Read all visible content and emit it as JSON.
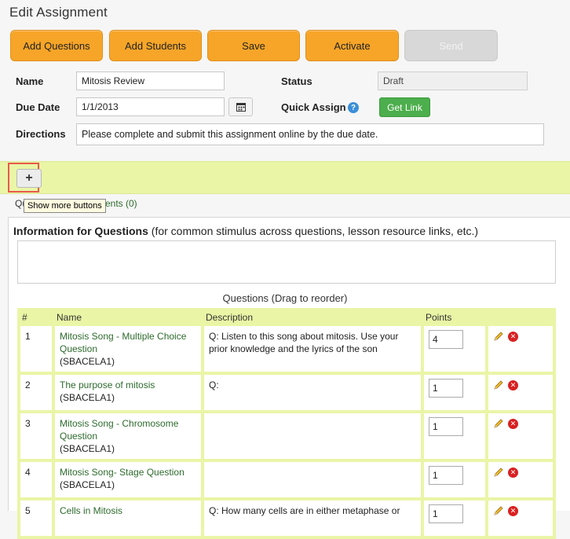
{
  "page": {
    "title": "Edit Assignment"
  },
  "toolbar": {
    "add_questions": "Add Questions",
    "add_students": "Add Students",
    "save": "Save",
    "activate": "Activate",
    "send": "Send"
  },
  "form": {
    "name_label": "Name",
    "name_value": "Mitosis Review",
    "status_label": "Status",
    "status_value": "Draft",
    "due_date_label": "Due Date",
    "due_date_value": "1/1/2013",
    "quick_assign_label": "Quick Assign",
    "get_link": "Get Link",
    "directions_label": "Directions",
    "directions_value": "Please complete and submit this assignment online by the due date."
  },
  "more_buttons": {
    "plus": "+",
    "tooltip": "Show more buttons"
  },
  "tabs": {
    "questions_prefix": "Qu",
    "students_suffix": "ents (0)"
  },
  "info": {
    "heading_bold": "Information for Questions",
    "heading_rest": " (for common stimulus across questions, lesson resource links, etc.)"
  },
  "questions": {
    "title": "Questions (Drag to reorder)",
    "headers": {
      "num": "#",
      "name": "Name",
      "description": "Description",
      "points": "Points"
    },
    "rows": [
      {
        "num": "1",
        "name": "Mitosis Song - Multiple Choice Question",
        "code": "(SBACELA1)",
        "description": "Q:   Listen to this song about mitosis. Use your prior knowledge and the lyrics of the son",
        "points": "4"
      },
      {
        "num": "2",
        "name": "The purpose of mitosis",
        "code": "(SBACELA1)",
        "description": "Q:",
        "points": "1"
      },
      {
        "num": "3",
        "name": "Mitosis Song - Chromosome Question",
        "code": "(SBACELA1)",
        "description": "",
        "points": "1"
      },
      {
        "num": "4",
        "name": "Mitosis Song- Stage Question",
        "code": "(SBACELA1)",
        "description": "",
        "points": "1"
      },
      {
        "num": "5",
        "name": "Cells in Mitosis",
        "code": "",
        "description": "Q:   How many cells are in either metaphase or",
        "points": "1"
      }
    ]
  },
  "colors": {
    "accent": "#f7a528",
    "band": "#eaf5a6",
    "green": "#4cae4c"
  }
}
